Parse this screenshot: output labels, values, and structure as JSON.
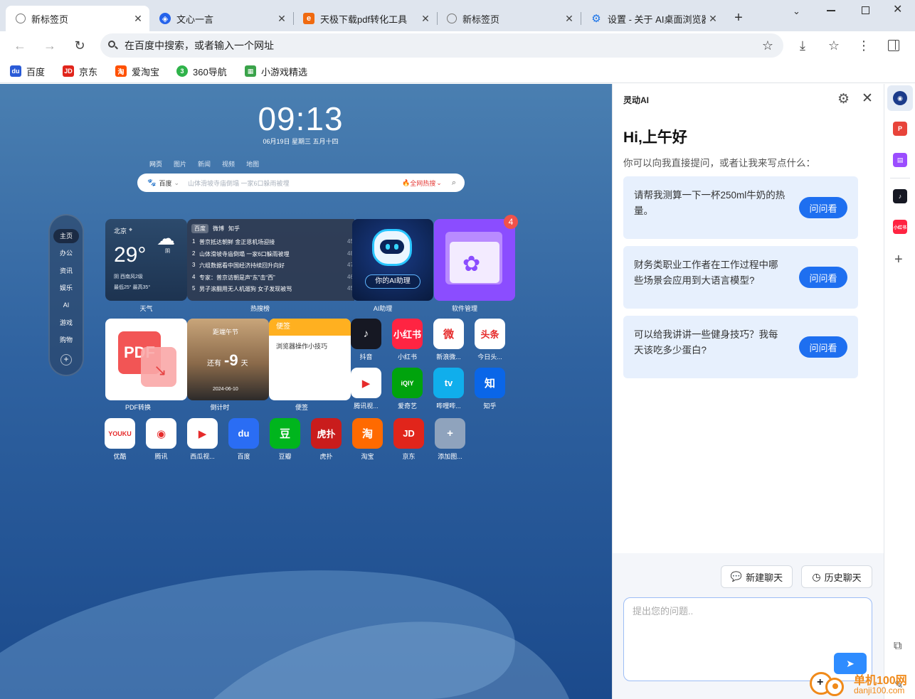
{
  "tabs": [
    {
      "label": "新标签页",
      "icon": "browser-tab-icon",
      "active": true
    },
    {
      "label": "文心一言",
      "icon": "wenxin-icon",
      "active": false
    },
    {
      "label": "天极下载pdf转化工具",
      "icon": "tianji-icon",
      "active": false
    },
    {
      "label": "新标签页",
      "icon": "browser-tab-icon",
      "active": false
    },
    {
      "label": "设置 - 关于 AI桌面浏览器",
      "icon": "settings-gear-icon",
      "active": false
    }
  ],
  "omnibox": {
    "placeholder": "在百度中搜索，或者输入一个网址"
  },
  "bookmarks": [
    {
      "label": "百度",
      "icon": "baidu-paw-icon",
      "color": "#2a5bd7"
    },
    {
      "label": "京东",
      "icon": "jd-icon",
      "color": "#e1251b"
    },
    {
      "label": "爱淘宝",
      "icon": "taobao-icon",
      "color": "#ff5000"
    },
    {
      "label": "360导航",
      "icon": "360-icon",
      "color": "#2fb34a"
    },
    {
      "label": "小游戏精选",
      "icon": "game-icon",
      "color": "#3aa34a"
    }
  ],
  "newtab": {
    "time": "09:13",
    "date": "06月19日 星期三 五月十四",
    "search_tabs": [
      "网页",
      "图片",
      "新闻",
      "视频",
      "地图"
    ],
    "search_engine": "百度",
    "search_placeholder": "山体滑坡寺庙倒塌 一家6口躲雨被埋",
    "hot_label": "全网热搜",
    "left_nav": [
      "主页",
      "办公",
      "资讯",
      "娱乐",
      "AI",
      "游戏",
      "购物"
    ],
    "weather": {
      "city": "北京",
      "temp": "29°",
      "condition": "阴",
      "wind": "阴  西南风2级",
      "range": "最低25° 最高35°",
      "label": "天气"
    },
    "hot": {
      "tabs": [
        "百度",
        "微博",
        "知乎"
      ],
      "items": [
        {
          "rank": "1",
          "text": "普京抵达朝鲜 金正恩机场迎接",
          "count": "45"
        },
        {
          "rank": "2",
          "text": "山体滑坡寺庙倒塌 一家6口躲雨被埋",
          "count": "48"
        },
        {
          "rank": "3",
          "text": "六组数据看中国经济持续回升向好",
          "count": "47"
        },
        {
          "rank": "4",
          "text": "专家：普京访朝是声“东”击“西”",
          "count": "46"
        },
        {
          "rank": "5",
          "text": "男子滚翻用无人机遛狗 女子发现被骂",
          "count": "45"
        }
      ],
      "label": "热搜榜"
    },
    "ai_card": {
      "caption": "你的AI助理",
      "label": "AI助理"
    },
    "soft_card": {
      "badge": "4",
      "label": "软件管理"
    },
    "pdf_card": {
      "text": "PDF",
      "label": "PDF转换"
    },
    "countdown": {
      "title": "距端午节",
      "prefix": "还有",
      "value": "-9",
      "unit": "天",
      "date": "2024-06-10",
      "label": "倒计时"
    },
    "notes": {
      "title": "便签",
      "text": "浏览器操作小技巧",
      "label": "便签"
    },
    "apps_row1": [
      {
        "label": "抖音",
        "glyph": "♪",
        "bg": "#161823"
      },
      {
        "label": "小红书",
        "glyph": "小红书",
        "bg": "#ff2442"
      },
      {
        "label": "新浪微...",
        "glyph": "微",
        "bg": "#ffffff"
      },
      {
        "label": "今日头...",
        "glyph": "头条",
        "bg": "#ffffff"
      }
    ],
    "apps_row2": [
      {
        "label": "腾讯视...",
        "glyph": "▶",
        "bg": "#ffffff"
      },
      {
        "label": "爱奇艺",
        "glyph": "iQIY",
        "bg": "#00a30d"
      },
      {
        "label": "哔哩哔...",
        "glyph": "tv",
        "bg": "#10aeec"
      },
      {
        "label": "知乎",
        "glyph": "知",
        "bg": "#0a66e8"
      }
    ],
    "apps_row3": [
      {
        "label": "优酷",
        "glyph": "YOUKU",
        "bg": "#ffffff"
      },
      {
        "label": "腾讯",
        "glyph": "◉",
        "bg": "#ffffff"
      },
      {
        "label": "西瓜视...",
        "glyph": "▶",
        "bg": "#ffffff"
      },
      {
        "label": "百度",
        "glyph": "du",
        "bg": "#2a6df4"
      },
      {
        "label": "豆瓣",
        "glyph": "豆",
        "bg": "#00b51d"
      },
      {
        "label": "虎扑",
        "glyph": "虎扑",
        "bg": "#c91c1c"
      },
      {
        "label": "淘宝",
        "glyph": "淘",
        "bg": "#ff6a00"
      },
      {
        "label": "京东",
        "glyph": "JD",
        "bg": "#e1251b"
      },
      {
        "label": "添加图...",
        "glyph": "+",
        "bg": "#8fa3bd"
      }
    ]
  },
  "ai_panel": {
    "title": "灵动AI",
    "greeting": "Hi,上午好",
    "subtitle": "你可以向我直接提问，或者让我来写点什么：",
    "ask_label": "问问看",
    "questions": [
      "请帮我测算一下一杯250ml牛奶的热量。",
      "财务类职业工作者在工作过程中哪些场景会应用到大语言模型?",
      "可以给我讲讲一些健身技巧？我每天该吃多少蛋白?"
    ],
    "new_chat": "新建聊天",
    "history_chat": "历史聊天",
    "input_placeholder": "提出您的问题.."
  },
  "watermark": {
    "name": "单机100网",
    "url": "danji100.com"
  },
  "colors": {
    "accent": "#1e6ff0",
    "tabbar": "#dfe5ee"
  }
}
